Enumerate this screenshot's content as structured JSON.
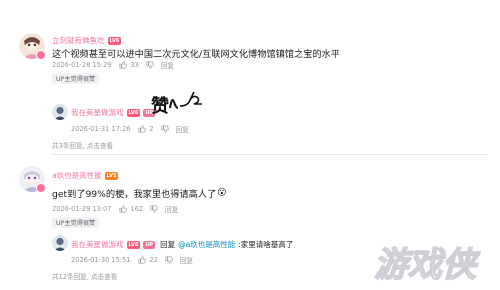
{
  "comments": [
    {
      "username": "立刻就有佛鱼吃",
      "level": "LV6",
      "text": "这个视频甚至可以进中国二次元文化/互联网文化博物馆镇馆之宝的水平",
      "date": "2026-01-28 15:29",
      "likes": "33",
      "reply_label": "回复",
      "up_tag": "UP主觉得很赞",
      "reply": {
        "username": "我在美星做游戏",
        "level": "LV6",
        "up_badge": "UP",
        "sticker_text": "赞",
        "date": "2026-01-31 17:26",
        "likes": "2",
        "reply_label": "回复"
      },
      "more_replies": "共3条回复, 点击查看"
    },
    {
      "username": "a玖也是高性能",
      "level": "LV5",
      "text": "get到了99%的梗，我家里也得请高人了",
      "emoji": "😮",
      "date": "2026-01-29 13:07",
      "likes": "162",
      "reply_label": "回复",
      "up_tag": "UP主觉得很赞",
      "reply": {
        "username": "我在美星做游戏",
        "level": "LV6",
        "up_badge": "UP",
        "reply_prefix": "回复",
        "mention": "@a玖也是高性能",
        "text": ":家里请啥基高了",
        "date": "2026-01-30 15:51",
        "likes": "22",
        "reply_label": "回复"
      },
      "more_replies": "共12条回复, 点击查看"
    }
  ],
  "watermark": "游戏侠",
  "colors": {
    "username_pink": "#fb7299",
    "mention_blue": "#008ac5",
    "meta_gray": "#9499a0"
  }
}
